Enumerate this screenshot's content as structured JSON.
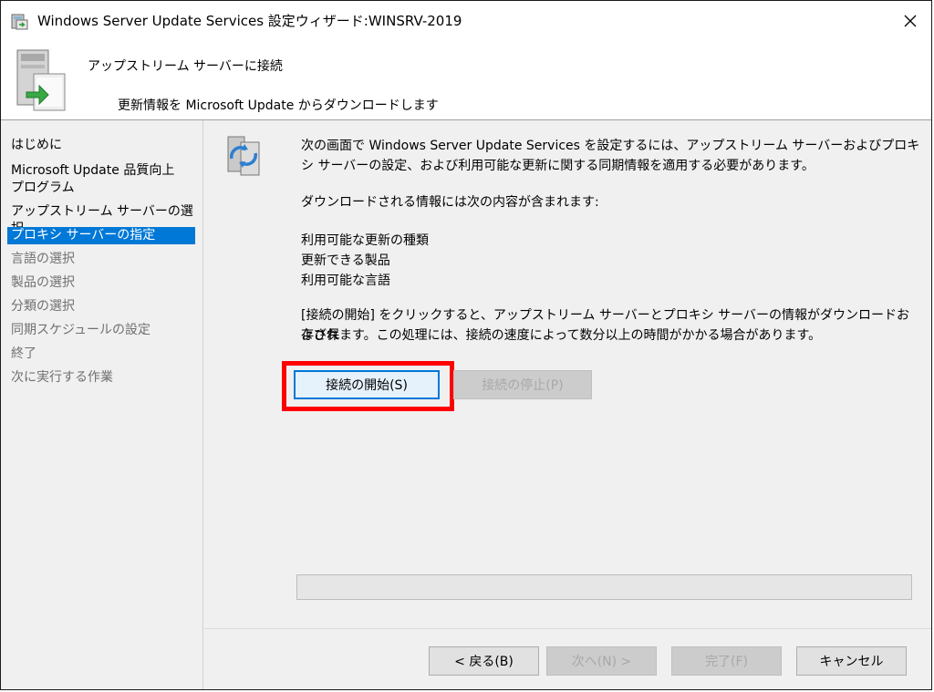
{
  "window": {
    "title": "Windows Server Update Services 設定ウィザード:WINSRV-2019",
    "close_glyph": "✕"
  },
  "header": {
    "heading": "アップストリーム サーバーに接続",
    "subtitle": "更新情報を Microsoft Update からダウンロードします",
    "icon": "server-arrow-icon"
  },
  "sidebar": {
    "items": [
      {
        "label": "はじめに",
        "state": "done"
      },
      {
        "label": "Microsoft Update 品質向上",
        "state": "done"
      },
      {
        "label": "プログラム",
        "state": "done"
      },
      {
        "label": "アップストリーム サーバーの選択",
        "state": "done"
      },
      {
        "label": "プロキシ サーバーの指定",
        "state": "active"
      },
      {
        "label": "言語の選択",
        "state": "pending"
      },
      {
        "label": "製品の選択",
        "state": "pending"
      },
      {
        "label": "分類の選択",
        "state": "pending"
      },
      {
        "label": "同期スケジュールの設定",
        "state": "pending"
      },
      {
        "label": "終了",
        "state": "pending"
      },
      {
        "label": "次に実行する作業",
        "state": "pending"
      }
    ]
  },
  "content": {
    "icon": "sync-servers-icon",
    "intro_line1": "次の画面で Windows Server Update Services を設定するには、アップストリーム サーバーおよびプロキ",
    "intro_line2": "シ サーバーの設定、および利用可能な更新に関する同期情報を適用する必要があります。",
    "download_info": "ダウンロードされる情報には次の内容が含まれます:",
    "list": [
      "利用可能な更新の種類",
      "更新できる製品",
      "利用可能な言語"
    ],
    "instruction_line1": "[接続の開始] をクリックすると、アップストリーム サーバーとプロキシ サーバーの情報がダウンロードおよび保",
    "instruction_line2": "存されます。この処理には、接続の速度によって数分以上の時間がかかる場合があります。",
    "start_button": "接続の開始(S)",
    "stop_button": "接続の停止(P)",
    "progress": 0
  },
  "footer": {
    "back": "< 戻る(B)",
    "next": "次へ(N) >",
    "finish": "完了(F)",
    "cancel": "キャンセル"
  },
  "colors": {
    "accent": "#0078d7",
    "highlight": "#ff0000"
  }
}
